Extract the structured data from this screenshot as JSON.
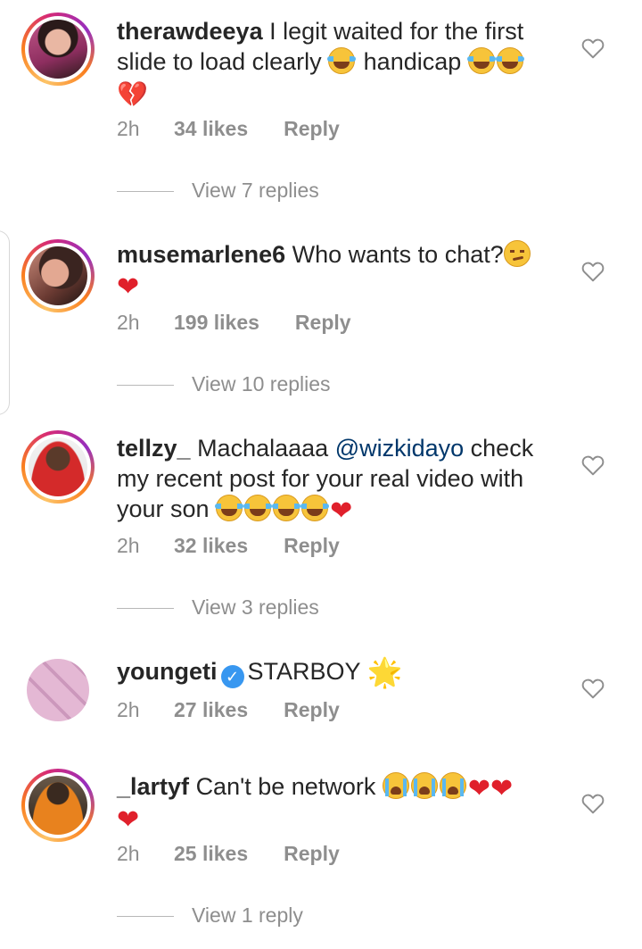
{
  "comments": [
    {
      "username": "therawdeeya",
      "text_1": "I legit waited for the first slide to load clearly",
      "text_2": "handicap",
      "time": "2h",
      "likes": "34 likes",
      "reply_label": "Reply",
      "view_replies": "View 7 replies",
      "avatar_colors": [
        "#b84d7a",
        "#2b1a1a"
      ]
    },
    {
      "username": "musemarlene6",
      "text_1": "Who wants to chat?",
      "time": "2h",
      "likes": "199 likes",
      "reply_label": "Reply",
      "view_replies": "View 10 replies",
      "avatar_colors": [
        "#c98a7a",
        "#3a2420"
      ]
    },
    {
      "username": "tellzy_",
      "text_1": "Machalaaaa",
      "mention": "@wizkidayo",
      "text_2": "check my recent post for your real video with your son",
      "time": "2h",
      "likes": "32 likes",
      "reply_label": "Reply",
      "view_replies": "View 3 replies",
      "avatar_colors": [
        "#d42a2a",
        "#5a3a2a"
      ]
    },
    {
      "username": "youngeti",
      "text_1": "STARBOY",
      "time": "2h",
      "likes": "27 likes",
      "reply_label": "Reply",
      "avatar_colors": [
        "#d8a8c8",
        "#6a4a5a"
      ]
    },
    {
      "username": "_lartyf",
      "text_1": "Can't be network",
      "time": "2h",
      "likes": "25 likes",
      "reply_label": "Reply",
      "view_replies": "View 1 reply",
      "avatar_colors": [
        "#e8821e",
        "#3a2a20"
      ]
    }
  ],
  "icons": {
    "like": "heart-outline-icon",
    "verified": "verified-badge-icon",
    "accent_mention": "#00376b",
    "heart_red": "#e0202b"
  }
}
